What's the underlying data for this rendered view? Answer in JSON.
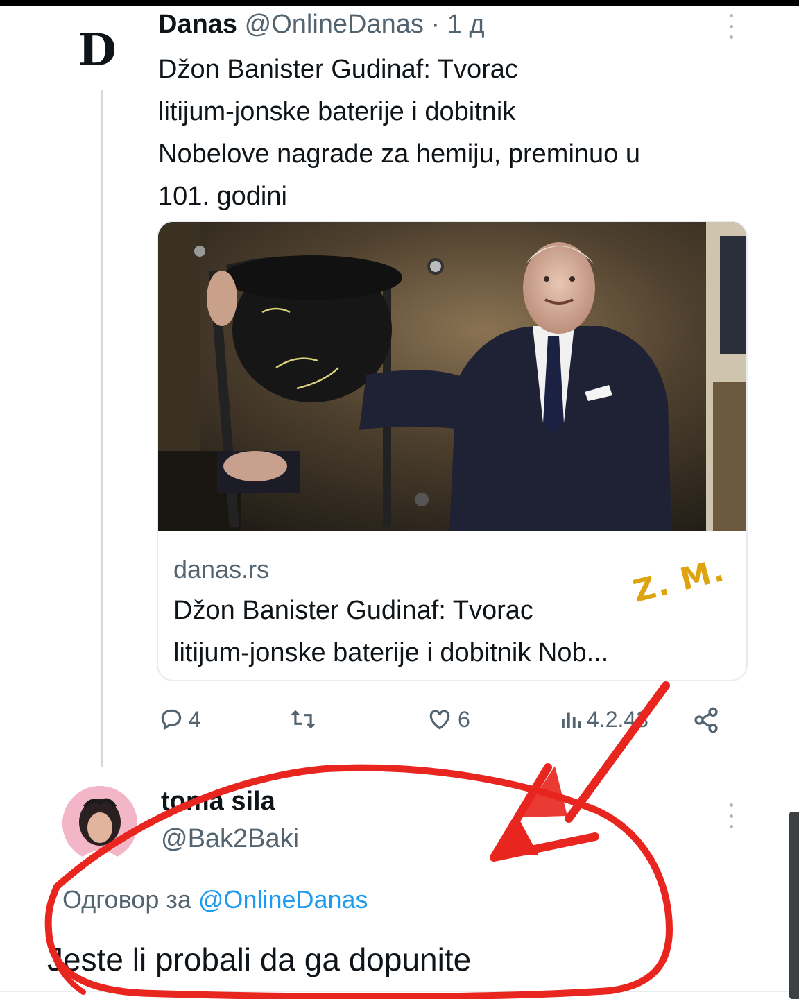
{
  "tweet": {
    "avatar_letter": "D",
    "author_name": "Danas",
    "author_meta": "@OnlineDanas · 1 д",
    "text_lines": [
      "Džon Banister Gudinaf: Tvorac",
      "litijum-jonske baterije i dobitnik",
      "Nobelove nagrade za hemiju, preminuo u",
      "101. godini"
    ],
    "card": {
      "domain": "danas.rs",
      "title_lines": [
        "Džon Banister Gudinaf: Tvorac",
        "litijum-jonske baterije i dobitnik Nob..."
      ]
    },
    "actions": {
      "replies": "4",
      "retweets": "",
      "likes": "6",
      "views": "4.2.43"
    }
  },
  "watermark": "Z. M.",
  "reply": {
    "author_name": "toma sila",
    "author_handle": "@Bak2Baki",
    "reply_to_prefix": "Одговор за",
    "reply_to_handle": "@OnlineDanas",
    "text": "Jeste li probali da ga dopunite"
  },
  "colors": {
    "text_primary": "#0f1419",
    "text_secondary": "#536471",
    "link": "#1d9bf0",
    "annotation_red": "#e8251e",
    "watermark": "#e0a310"
  },
  "icons": [
    "more-vertical-icon",
    "reply-icon",
    "retweet-icon",
    "like-icon",
    "views-icon",
    "share-icon"
  ]
}
